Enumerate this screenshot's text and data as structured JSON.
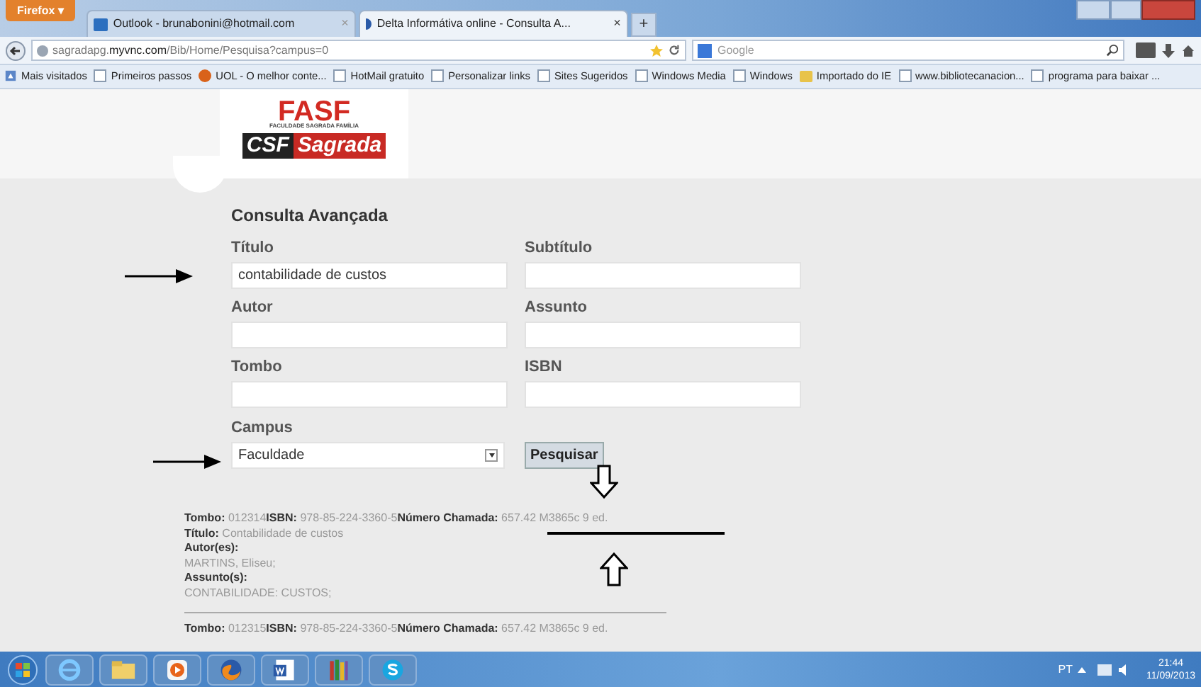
{
  "browser": {
    "menu_button": "Firefox ▾",
    "tabs": [
      {
        "label": "Outlook - brunabonini@hotmail.com",
        "selected": false,
        "close": "×"
      },
      {
        "label": "Delta Informátiva online - Consulta A...",
        "selected": true,
        "close": "×"
      }
    ],
    "new_tab": "+",
    "url_host": "sagradapg.",
    "url_domain": "myvnc.com",
    "url_path": "/Bib/Home/Pesquisa?campus=0",
    "search_placeholder": "Google",
    "bookmarks": [
      {
        "label": "Mais visitados",
        "kind": "star"
      },
      {
        "label": "Primeiros passos",
        "kind": "page"
      },
      {
        "label": "UOL - O melhor conte...",
        "kind": "uol"
      },
      {
        "label": "HotMail gratuito",
        "kind": "page"
      },
      {
        "label": "Personalizar links",
        "kind": "page"
      },
      {
        "label": "Sites Sugeridos",
        "kind": "page"
      },
      {
        "label": "Windows Media",
        "kind": "page"
      },
      {
        "label": "Windows",
        "kind": "page"
      },
      {
        "label": "Importado do IE",
        "kind": "folder"
      },
      {
        "label": "www.bibliotecanacion...",
        "kind": "page"
      },
      {
        "label": "programa para baixar ...",
        "kind": "page"
      }
    ]
  },
  "logo": {
    "top": "FASF",
    "subtitle": "FACULDADE SAGRADA FAMÍLIA",
    "left": "CSF",
    "right": "Sagrada"
  },
  "form": {
    "heading": "Consulta Avançada",
    "fields": [
      {
        "label": "Título",
        "value": "contabilidade de custos"
      },
      {
        "label": "Subtítulo"
      },
      {
        "label": "Autor"
      },
      {
        "label": "Assunto"
      },
      {
        "label": "Tombo"
      },
      {
        "label": "ISBN"
      }
    ],
    "campus": {
      "label": "Campus",
      "value": "Faculdade"
    },
    "search_button": "Pesquisar"
  },
  "results": [
    {
      "line": [
        {
          "label": "Tombo:",
          "value": "012314"
        },
        {
          "label": "ISBN:",
          "value": "978-85-224-3360-5"
        },
        {
          "label": "Número Chamada:",
          "value": "657.42 M3865c 9 ed."
        }
      ],
      "details": [
        {
          "label": "Título:",
          "value": "Contabilidade de custos",
          "kind": "inline"
        },
        {
          "label": "Autor(es):",
          "value": "MARTINS, Eliseu;",
          "kind": "block"
        },
        {
          "label": "Assunto(s):",
          "value": "CONTABILIDADE: CUSTOS;",
          "kind": "block"
        }
      ]
    },
    {
      "line": [
        {
          "label": "Tombo:",
          "value": "012315"
        },
        {
          "label": "ISBN:",
          "value": "978-85-224-3360-5"
        },
        {
          "label": "Número Chamada:",
          "value": "657.42 M3865c 9 ed."
        }
      ]
    }
  ],
  "taskbar": {
    "language": "PT",
    "time": "21:44",
    "date": "11/09/2013",
    "apps": [
      {
        "kind": "ie"
      },
      {
        "kind": "folder"
      },
      {
        "kind": "media"
      },
      {
        "kind": "firefox"
      },
      {
        "kind": "word"
      },
      {
        "kind": "books"
      },
      {
        "kind": "skype"
      }
    ]
  }
}
